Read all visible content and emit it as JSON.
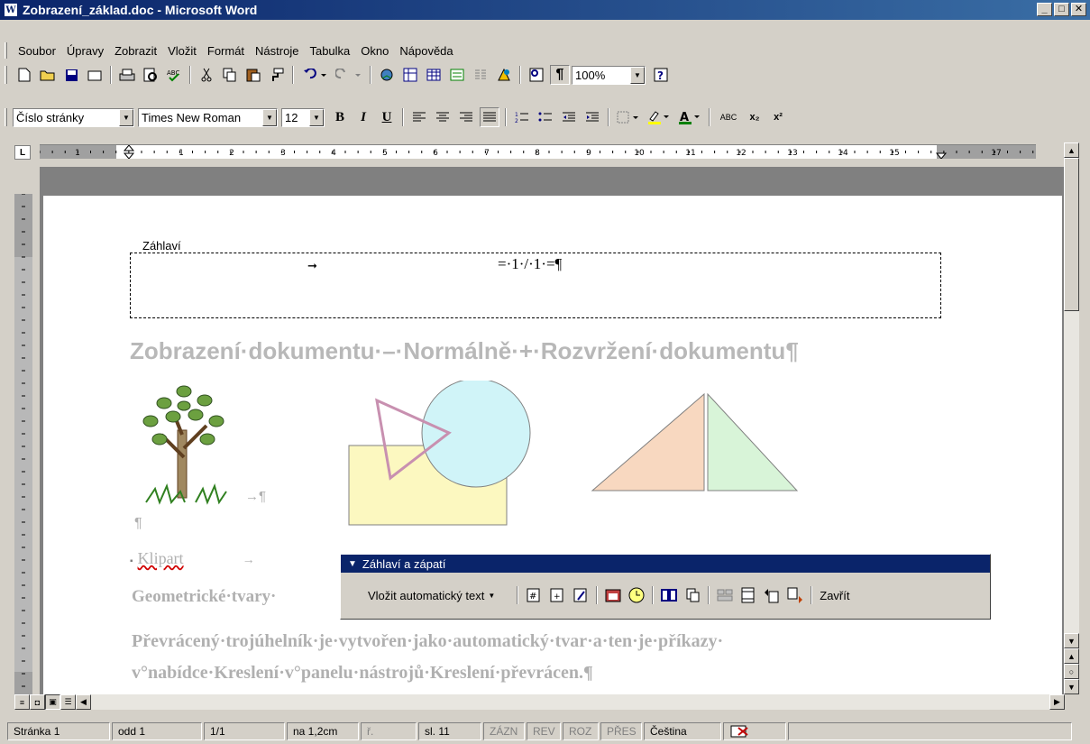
{
  "window": {
    "title": "Zobrazení_základ.doc - Microsoft Word",
    "min": "_",
    "max": "□",
    "close": "✕",
    "doc_icon": "W"
  },
  "menu": [
    "Soubor",
    "Úpravy",
    "Zobrazit",
    "Vložit",
    "Formát",
    "Nástroje",
    "Tabulka",
    "Okno",
    "Nápověda"
  ],
  "standard_toolbar": {
    "zoom": "100%",
    "pilcrow": "¶"
  },
  "formatting_toolbar": {
    "style": "Číslo stránky",
    "font": "Times New Roman",
    "size": "12",
    "bold": "B",
    "italic": "I",
    "underline": "U",
    "abc": "ABC",
    "sub": "x₂",
    "sup": "x²"
  },
  "ruler": {
    "ticks": [
      "1",
      "1",
      "2",
      "3",
      "4",
      "5",
      "6",
      "7",
      "8",
      "9",
      "10",
      "11",
      "12",
      "13",
      "14",
      "15",
      "17"
    ]
  },
  "document": {
    "header_label": "Záhlaví",
    "header_text": "=·1·/·1·=¶",
    "heading": "Zobrazení·dokumentu·–·Normálně·+·Rozvržení·dokumentu¶",
    "tree_para": "→¶",
    "empty_para": "¶",
    "klipart": "Klipart",
    "geo": "Geometrické·tvary·",
    "para1": "Převrácený·trojúhelník·je·vytvořen·jako·automatický·tvar·a·ten·je·příkazy·",
    "para2": "v°nabídce·Kreslení·v°panelu·nástrojů·Kreslení·převrácen.¶"
  },
  "hf_toolbar": {
    "title": "Záhlaví a zápatí",
    "insert_auto_text": "Vložit automatický text",
    "close": "Zavřít"
  },
  "status": {
    "page": "Stránka 1",
    "section": "odd 1",
    "pages": "1/1",
    "at": "na 1,2cm",
    "line": "ř.",
    "col": "sl. 11",
    "rec": "ZÁZN",
    "rev": "REV",
    "ext": "ROZ",
    "ovr": "PŘES",
    "language": "Čeština"
  },
  "colors": {
    "title_bar": "#0a246a",
    "triangle_left": "#f8d8c0",
    "triangle_right": "#d8f4d8",
    "circle": "#d0f4f8",
    "rect": "#fcf8c0",
    "pink_triangle": "#c890b0"
  }
}
